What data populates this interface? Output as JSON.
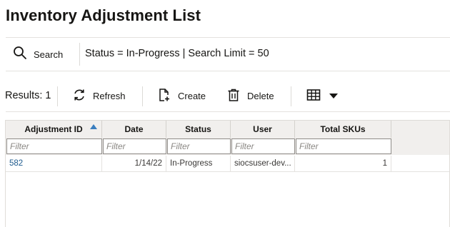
{
  "page": {
    "title": "Inventory Adjustment List"
  },
  "search": {
    "label": "Search",
    "summary": "Status = In-Progress | Search Limit = 50"
  },
  "toolbar": {
    "results": "Results: 1",
    "refresh": "Refresh",
    "create": "Create",
    "delete": "Delete"
  },
  "table": {
    "columns": [
      "Adjustment ID",
      "Date",
      "Status",
      "User",
      "Total SKUs"
    ],
    "filter_placeholder": "Filter",
    "sorted_column": "Adjustment ID",
    "sort_direction": "ascending",
    "rows": [
      [
        "582",
        "1/14/22",
        "In-Progress",
        "siocsuser-dev...",
        "1"
      ]
    ]
  },
  "colors": {
    "accent": "#3a7ebf",
    "link": "#1f5b8e",
    "header_bg": "#f1efed"
  }
}
